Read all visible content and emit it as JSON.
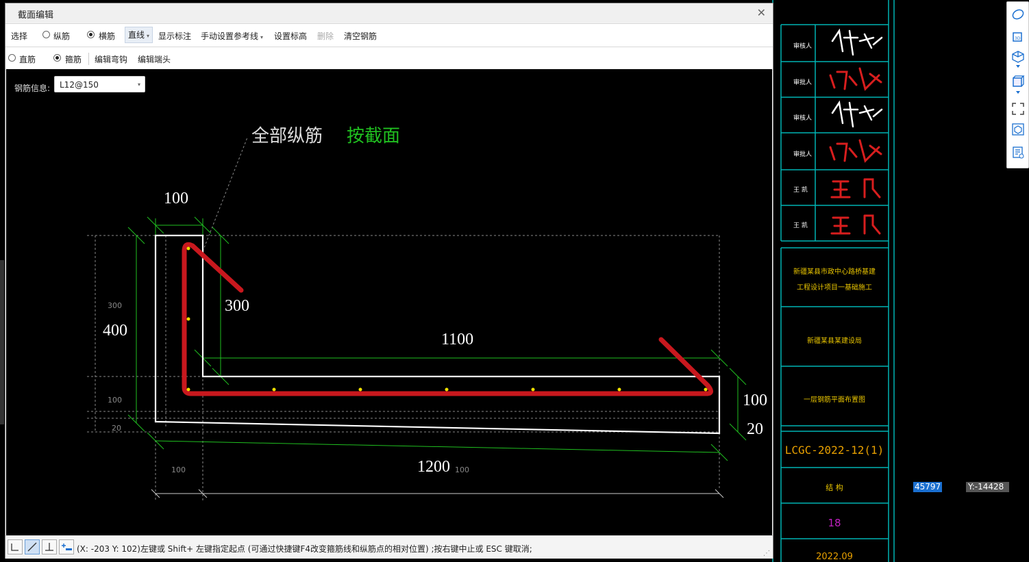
{
  "dialog": {
    "title": "截面编辑",
    "close_icon": "close-icon"
  },
  "toolbar1": {
    "select": "选择",
    "longitudinal": "纵筋",
    "transverse": "横筋",
    "line_type": "直线",
    "show_dims": "显示标注",
    "manual_ref": "手动设置参考线",
    "set_elevation": "设置标高",
    "delete": "删除",
    "clear_rebar": "清空钢筋"
  },
  "toolbar2": {
    "straight": "直筋",
    "stirrup": "箍筋",
    "edit_hook": "编辑弯钩",
    "edit_end": "编辑端头"
  },
  "rebar_info": {
    "label": "钢筋信息:",
    "value": "L12@150"
  },
  "drawing": {
    "leader_label": "全部纵筋",
    "leader_label_green": "按截面",
    "dims": {
      "top_width": "100",
      "hook_len": "300",
      "height": "400",
      "inner_len": "1100",
      "right_height": "100",
      "cover": "20",
      "total_len": "1200"
    },
    "small_dims": {
      "left_300": "300",
      "left_100": "100",
      "left_20": "20",
      "bottom_100a": "100",
      "bottom_100b": "100"
    }
  },
  "status": {
    "text": "(X: -203 Y: 102)左键或 Shift+ 左键指定起点 (可通过快捷键F4改变箍筋线和纵筋点的相对位置) ;按右键中止或 ESC 键取消;"
  },
  "title_block": {
    "stamp_labels": [
      "审核人",
      "审批人",
      "审核人",
      "审批人",
      "王 凯",
      "王 凯"
    ],
    "project_line1": "新疆某县市政中心路桥基建",
    "project_line2": "工程设计项目一基础施工",
    "unit": "新疆某县某建设局",
    "sheet_title": "一层钢筋平面布置图",
    "drawing_number": "LCGC-2022-12(1)",
    "sheet_label": "结 构",
    "sheet_num": "18",
    "date": "2022.09"
  },
  "coords": {
    "x": "45797",
    "y": "Y:-14428"
  },
  "colors": {
    "rebar": "#c8181e",
    "outline": "#ffffff",
    "dim_green": "#20c020",
    "cyan_frame": "#00b4b4",
    "yellow_points": "#f0e000"
  }
}
